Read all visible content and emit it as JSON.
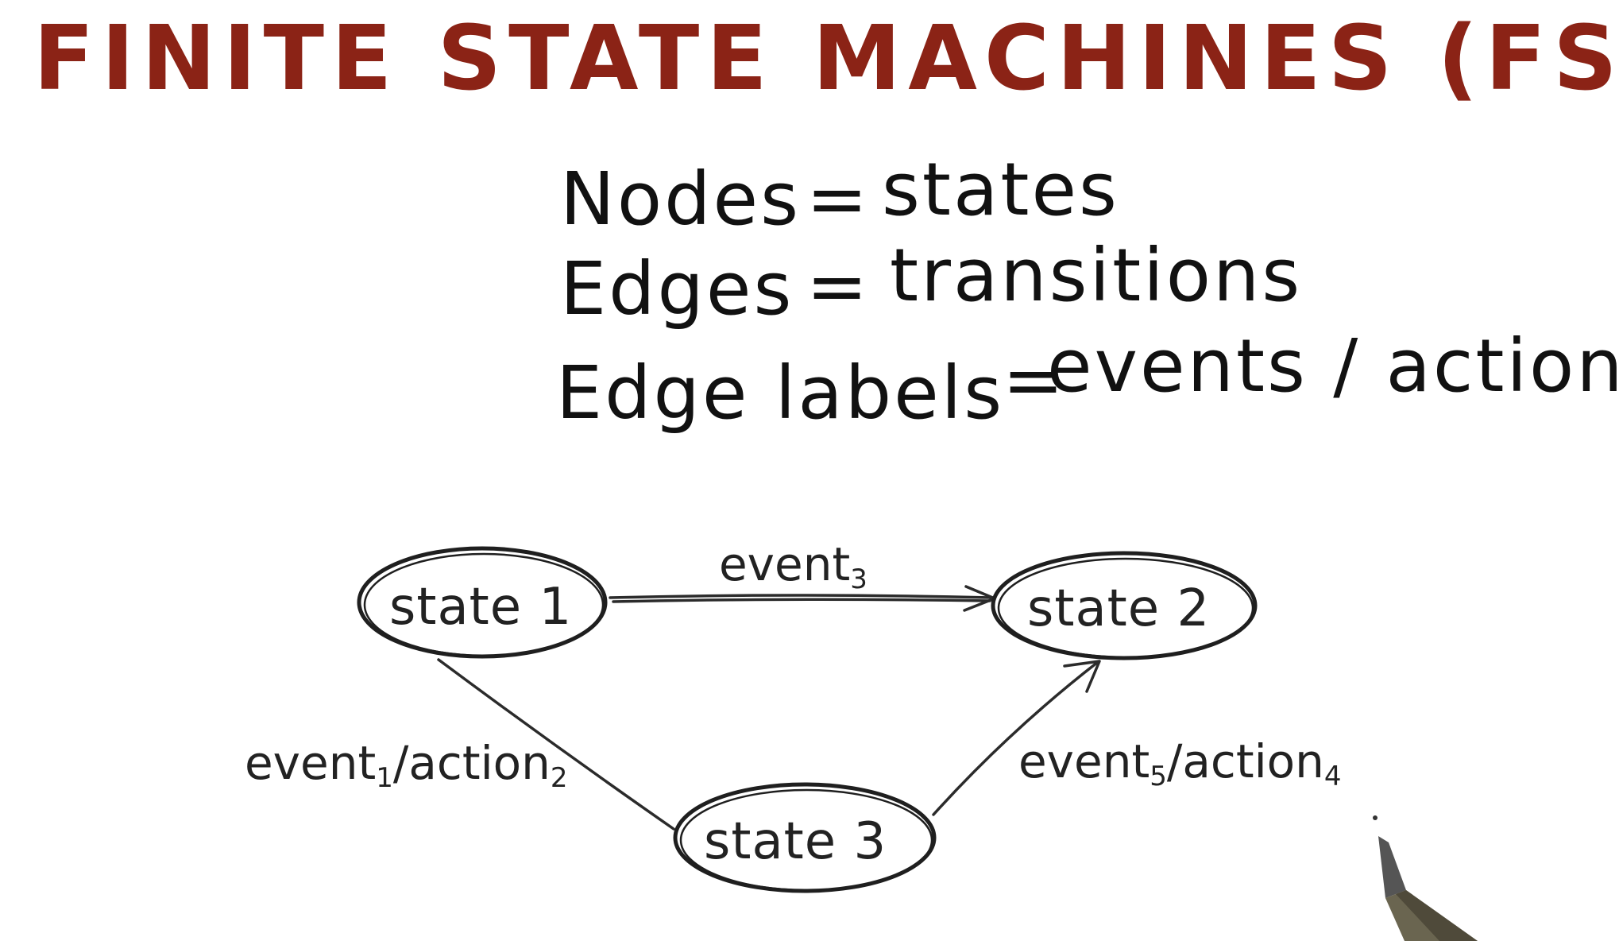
{
  "title": "FINITE STATE MACHINES (FSM)",
  "definitions": [
    {
      "left": "Nodes",
      "right": "states"
    },
    {
      "left": "Edges",
      "right": "transitions"
    },
    {
      "left": "Edge labels",
      "right": "events / actions"
    }
  ],
  "equals_sign": "=",
  "colors": {
    "title": "#8b2316",
    "ink": "#1f1f1f"
  },
  "diagram": {
    "states": {
      "state1": "state 1",
      "state2": "state 2",
      "state3": "state 3"
    },
    "edges": {
      "s1_to_s2": {
        "event": "event",
        "event_sub": "3"
      },
      "s1_to_s3": {
        "event": "event",
        "event_sub": "1",
        "separator": "/",
        "action": "action",
        "action_sub": "2"
      },
      "s3_to_s2": {
        "event": "event",
        "event_sub": "5",
        "separator": "/",
        "action": "action",
        "action_sub": "4"
      }
    }
  },
  "decorations": {
    "pen_icon": "marker-pen-icon"
  }
}
